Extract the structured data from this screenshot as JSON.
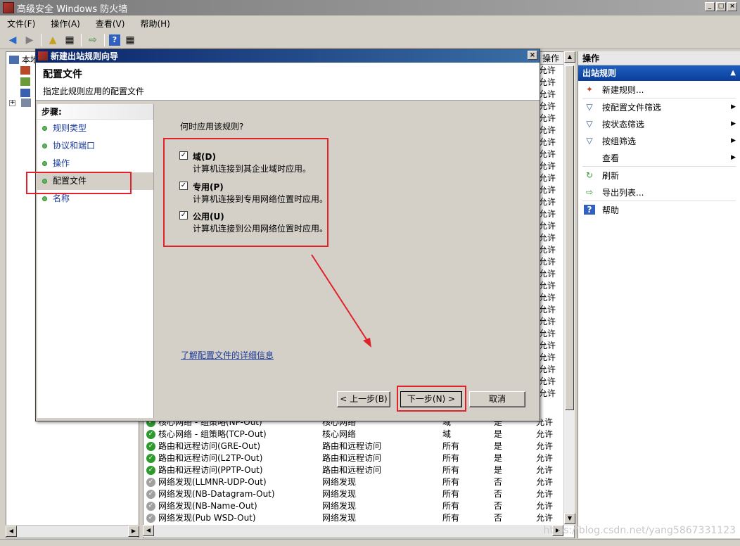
{
  "window": {
    "title": "高级安全 Windows 防火墙"
  },
  "menu": [
    "文件(F)",
    "操作(A)",
    "查看(V)",
    "帮助(H)"
  ],
  "tree": {
    "root_label": "本地"
  },
  "list": {
    "header_last": "操作",
    "rest_values": [
      "允许",
      "允许",
      "允许",
      "允许",
      "允许",
      "允许",
      "允许",
      "允许",
      "允许",
      "允许",
      "允许",
      "允许",
      "允许",
      "允许",
      "允许",
      "允许",
      "允许",
      "允许",
      "允许",
      "允许",
      "允许",
      "允许",
      "允许",
      "允许",
      "允许",
      "允许",
      "允许",
      "允许"
    ],
    "rows": [
      {
        "status": "enabled",
        "name": "核心网络 - 组策略(NP-Out)",
        "group": "核心网络",
        "profile": "域",
        "enabled": "是",
        "action": "允许"
      },
      {
        "status": "enabled",
        "name": "核心网络 - 组策略(TCP-Out)",
        "group": "核心网络",
        "profile": "域",
        "enabled": "是",
        "action": "允许"
      },
      {
        "status": "enabled",
        "name": "路由和远程访问(GRE-Out)",
        "group": "路由和远程访问",
        "profile": "所有",
        "enabled": "是",
        "action": "允许"
      },
      {
        "status": "enabled",
        "name": "路由和远程访问(L2TP-Out)",
        "group": "路由和远程访问",
        "profile": "所有",
        "enabled": "是",
        "action": "允许"
      },
      {
        "status": "enabled",
        "name": "路由和远程访问(PPTP-Out)",
        "group": "路由和远程访问",
        "profile": "所有",
        "enabled": "是",
        "action": "允许"
      },
      {
        "status": "disabled",
        "name": "网络发现(LLMNR-UDP-Out)",
        "group": "网络发现",
        "profile": "所有",
        "enabled": "否",
        "action": "允许"
      },
      {
        "status": "disabled",
        "name": "网络发现(NB-Datagram-Out)",
        "group": "网络发现",
        "profile": "所有",
        "enabled": "否",
        "action": "允许"
      },
      {
        "status": "disabled",
        "name": "网络发现(NB-Name-Out)",
        "group": "网络发现",
        "profile": "所有",
        "enabled": "否",
        "action": "允许"
      },
      {
        "status": "disabled",
        "name": "网络发现(Pub WSD-Out)",
        "group": "网络发现",
        "profile": "所有",
        "enabled": "否",
        "action": "允许"
      }
    ]
  },
  "actions": {
    "title": "操作",
    "section": "出站规则",
    "items": [
      {
        "icon": "new-rule-icon",
        "label": "新建规则...",
        "submenu": false
      },
      {
        "icon": "filter-icon",
        "label": "按配置文件筛选",
        "submenu": true
      },
      {
        "icon": "filter-icon",
        "label": "按状态筛选",
        "submenu": true
      },
      {
        "icon": "filter-icon",
        "label": "按组筛选",
        "submenu": true
      },
      {
        "icon": "",
        "label": "查看",
        "submenu": true
      },
      {
        "icon": "refresh-icon",
        "label": "刷新",
        "submenu": false
      },
      {
        "icon": "export-icon",
        "label": "导出列表...",
        "submenu": false
      },
      {
        "icon": "help-icon",
        "label": "帮助",
        "submenu": false
      }
    ]
  },
  "watermark": "https://blog.csdn.net/yang5867331123",
  "dialog": {
    "title": "新建出站规则向导",
    "header_title": "配置文件",
    "header_subtitle": "指定此规则应用的配置文件",
    "steps_title": "步骤:",
    "steps": [
      "规则类型",
      "协议和端口",
      "操作",
      "配置文件",
      "名称"
    ],
    "active_step": 3,
    "question": "何时应用该规则?",
    "options": [
      {
        "label": "域(D)",
        "desc": "计算机连接到其企业域时应用。",
        "checked": true
      },
      {
        "label": "专用(P)",
        "desc": "计算机连接到专用网络位置时应用。",
        "checked": true
      },
      {
        "label": "公用(U)",
        "desc": "计算机连接到公用网络位置时应用。",
        "checked": true
      }
    ],
    "learn_link": "了解配置文件的详细信息",
    "buttons": {
      "back": "< 上一步(B)",
      "next": "下一步(N) >",
      "cancel": "取消"
    }
  },
  "colors": {
    "annotation_red": "#e0232b",
    "title_blue": "#0a246a",
    "link_blue": "#1a3a9a"
  }
}
